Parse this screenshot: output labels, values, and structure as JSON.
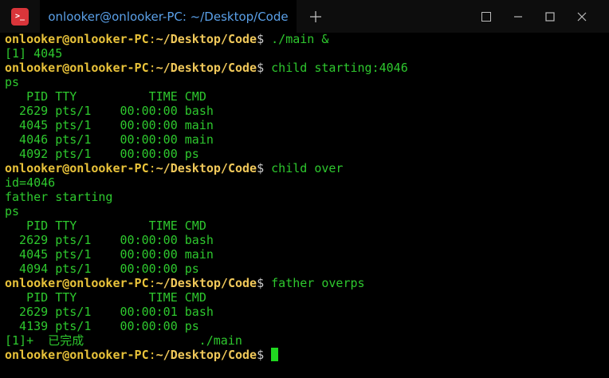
{
  "window": {
    "tab_title": "onlooker@onlooker-PC: ~/Desktop/Code",
    "app_icon_text": ">_",
    "colors": {
      "background": "#000000",
      "output_text": "#2ec82e",
      "prompt_text": "#e8c23a",
      "tab_text": "#5aa0e8",
      "cursor": "#20d820",
      "app_icon": "#d9353a"
    },
    "icons": {
      "app": "terminal-icon",
      "new_tab": "plus-icon",
      "menu": "menu-icon",
      "minimize": "minimize-icon",
      "maximize": "maximize-icon",
      "close": "close-icon"
    }
  },
  "prompt": {
    "user_host": "onlooker@onlooker-PC",
    "colon": ":",
    "path": "~/Desktop/Code",
    "dollar": "$ "
  },
  "lines": [
    {
      "prompt": true,
      "text": "./main &"
    },
    {
      "prompt": false,
      "text": "[1] 4045"
    },
    {
      "prompt": true,
      "text": "child starting:4046"
    },
    {
      "prompt": false,
      "text": "ps"
    },
    {
      "prompt": false,
      "text": "   PID TTY          TIME CMD"
    },
    {
      "prompt": false,
      "text": "  2629 pts/1    00:00:00 bash"
    },
    {
      "prompt": false,
      "text": "  4045 pts/1    00:00:00 main"
    },
    {
      "prompt": false,
      "text": "  4046 pts/1    00:00:00 main"
    },
    {
      "prompt": false,
      "text": "  4092 pts/1    00:00:00 ps"
    },
    {
      "prompt": true,
      "text": "child over"
    },
    {
      "prompt": false,
      "text": "id=4046"
    },
    {
      "prompt": false,
      "text": "father starting"
    },
    {
      "prompt": false,
      "text": "ps"
    },
    {
      "prompt": false,
      "text": "   PID TTY          TIME CMD"
    },
    {
      "prompt": false,
      "text": "  2629 pts/1    00:00:00 bash"
    },
    {
      "prompt": false,
      "text": "  4045 pts/1    00:00:00 main"
    },
    {
      "prompt": false,
      "text": "  4094 pts/1    00:00:00 ps"
    },
    {
      "prompt": true,
      "text": "father overps"
    },
    {
      "prompt": false,
      "text": "   PID TTY          TIME CMD"
    },
    {
      "prompt": false,
      "text": "  2629 pts/1    00:00:01 bash"
    },
    {
      "prompt": false,
      "text": "  4139 pts/1    00:00:00 ps"
    },
    {
      "prompt": false,
      "text": "[1]+  已完成                ./main"
    },
    {
      "prompt": true,
      "text": "",
      "cursor": true
    }
  ]
}
